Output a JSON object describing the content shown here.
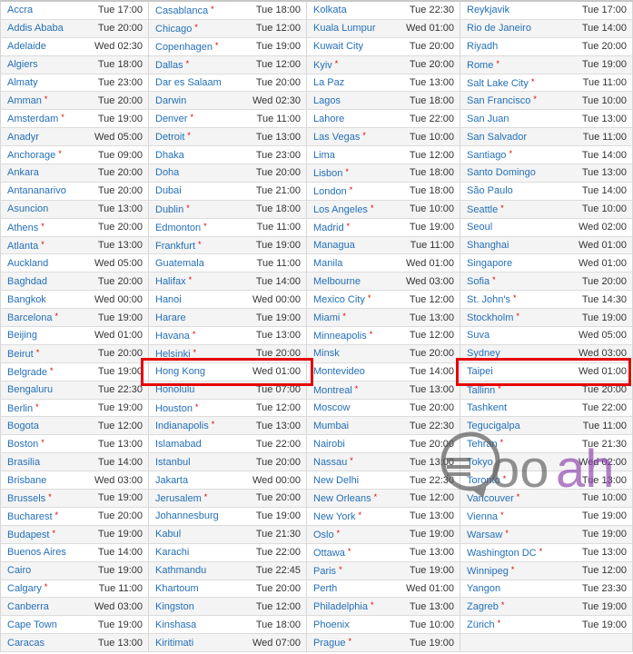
{
  "dst_marker": "*",
  "highlight_color": "#e50000",
  "link_color": "#2470b8",
  "watermark": {
    "text_gray": "Qoo",
    "text_purple": "ah",
    "gray": "#555555",
    "purple": "#8e44ad"
  },
  "highlighted_cities": [
    "Hong Kong",
    "Taipei"
  ],
  "columns": [
    [
      {
        "city": "Accra",
        "time": "Tue 17:00",
        "dst": false
      },
      {
        "city": "Addis Ababa",
        "time": "Tue 20:00",
        "dst": false
      },
      {
        "city": "Adelaide",
        "time": "Wed 02:30",
        "dst": false
      },
      {
        "city": "Algiers",
        "time": "Tue 18:00",
        "dst": false
      },
      {
        "city": "Almaty",
        "time": "Tue 23:00",
        "dst": false
      },
      {
        "city": "Amman",
        "time": "Tue 20:00",
        "dst": true
      },
      {
        "city": "Amsterdam",
        "time": "Tue 19:00",
        "dst": true
      },
      {
        "city": "Anadyr",
        "time": "Wed 05:00",
        "dst": false
      },
      {
        "city": "Anchorage",
        "time": "Tue 09:00",
        "dst": true
      },
      {
        "city": "Ankara",
        "time": "Tue 20:00",
        "dst": false
      },
      {
        "city": "Antananarivo",
        "time": "Tue 20:00",
        "dst": false
      },
      {
        "city": "Asuncion",
        "time": "Tue 13:00",
        "dst": false
      },
      {
        "city": "Athens",
        "time": "Tue 20:00",
        "dst": true
      },
      {
        "city": "Atlanta",
        "time": "Tue 13:00",
        "dst": true
      },
      {
        "city": "Auckland",
        "time": "Wed 05:00",
        "dst": false
      },
      {
        "city": "Baghdad",
        "time": "Tue 20:00",
        "dst": false
      },
      {
        "city": "Bangkok",
        "time": "Wed 00:00",
        "dst": false
      },
      {
        "city": "Barcelona",
        "time": "Tue 19:00",
        "dst": true
      },
      {
        "city": "Beijing",
        "time": "Wed 01:00",
        "dst": false
      },
      {
        "city": "Beirut",
        "time": "Tue 20:00",
        "dst": true
      },
      {
        "city": "Belgrade",
        "time": "Tue 19:00",
        "dst": true
      },
      {
        "city": "Bengaluru",
        "time": "Tue 22:30",
        "dst": false
      },
      {
        "city": "Berlin",
        "time": "Tue 19:00",
        "dst": true
      },
      {
        "city": "Bogota",
        "time": "Tue 12:00",
        "dst": false
      },
      {
        "city": "Boston",
        "time": "Tue 13:00",
        "dst": true
      },
      {
        "city": "Brasilia",
        "time": "Tue 14:00",
        "dst": false
      },
      {
        "city": "Brisbane",
        "time": "Wed 03:00",
        "dst": false
      },
      {
        "city": "Brussels",
        "time": "Tue 19:00",
        "dst": true
      },
      {
        "city": "Bucharest",
        "time": "Tue 20:00",
        "dst": true
      },
      {
        "city": "Budapest",
        "time": "Tue 19:00",
        "dst": true
      },
      {
        "city": "Buenos Aires",
        "time": "Tue 14:00",
        "dst": false
      },
      {
        "city": "Cairo",
        "time": "Tue 19:00",
        "dst": false
      },
      {
        "city": "Calgary",
        "time": "Tue 11:00",
        "dst": true
      },
      {
        "city": "Canberra",
        "time": "Wed 03:00",
        "dst": false
      },
      {
        "city": "Cape Town",
        "time": "Tue 19:00",
        "dst": false
      },
      {
        "city": "Caracas",
        "time": "Tue 13:00",
        "dst": false
      }
    ],
    [
      {
        "city": "Casablanca",
        "time": "Tue 18:00",
        "dst": true
      },
      {
        "city": "Chicago",
        "time": "Tue 12:00",
        "dst": true
      },
      {
        "city": "Copenhagen",
        "time": "Tue 19:00",
        "dst": true
      },
      {
        "city": "Dallas",
        "time": "Tue 12:00",
        "dst": true
      },
      {
        "city": "Dar es Salaam",
        "time": "Tue 20:00",
        "dst": false
      },
      {
        "city": "Darwin",
        "time": "Wed 02:30",
        "dst": false
      },
      {
        "city": "Denver",
        "time": "Tue 11:00",
        "dst": true
      },
      {
        "city": "Detroit",
        "time": "Tue 13:00",
        "dst": true
      },
      {
        "city": "Dhaka",
        "time": "Tue 23:00",
        "dst": false
      },
      {
        "city": "Doha",
        "time": "Tue 20:00",
        "dst": false
      },
      {
        "city": "Dubai",
        "time": "Tue 21:00",
        "dst": false
      },
      {
        "city": "Dublin",
        "time": "Tue 18:00",
        "dst": true
      },
      {
        "city": "Edmonton",
        "time": "Tue 11:00",
        "dst": true
      },
      {
        "city": "Frankfurt",
        "time": "Tue 19:00",
        "dst": true
      },
      {
        "city": "Guatemala",
        "time": "Tue 11:00",
        "dst": false
      },
      {
        "city": "Halifax",
        "time": "Tue 14:00",
        "dst": true
      },
      {
        "city": "Hanoi",
        "time": "Wed 00:00",
        "dst": false
      },
      {
        "city": "Harare",
        "time": "Tue 19:00",
        "dst": false
      },
      {
        "city": "Havana",
        "time": "Tue 13:00",
        "dst": true
      },
      {
        "city": "Helsinki",
        "time": "Tue 20:00",
        "dst": true
      },
      {
        "city": "Hong Kong",
        "time": "Wed 01:00",
        "dst": false
      },
      {
        "city": "Honolulu",
        "time": "Tue 07:00",
        "dst": false
      },
      {
        "city": "Houston",
        "time": "Tue 12:00",
        "dst": true
      },
      {
        "city": "Indianapolis",
        "time": "Tue 13:00",
        "dst": true
      },
      {
        "city": "Islamabad",
        "time": "Tue 22:00",
        "dst": false
      },
      {
        "city": "Istanbul",
        "time": "Tue 20:00",
        "dst": false
      },
      {
        "city": "Jakarta",
        "time": "Wed 00:00",
        "dst": false
      },
      {
        "city": "Jerusalem",
        "time": "Tue 20:00",
        "dst": true
      },
      {
        "city": "Johannesburg",
        "time": "Tue 19:00",
        "dst": false
      },
      {
        "city": "Kabul",
        "time": "Tue 21:30",
        "dst": false
      },
      {
        "city": "Karachi",
        "time": "Tue 22:00",
        "dst": false
      },
      {
        "city": "Kathmandu",
        "time": "Tue 22:45",
        "dst": false
      },
      {
        "city": "Khartoum",
        "time": "Tue 20:00",
        "dst": false
      },
      {
        "city": "Kingston",
        "time": "Tue 12:00",
        "dst": false
      },
      {
        "city": "Kinshasa",
        "time": "Tue 18:00",
        "dst": false
      },
      {
        "city": "Kiritimati",
        "time": "Wed 07:00",
        "dst": false
      }
    ],
    [
      {
        "city": "Kolkata",
        "time": "Tue 22:30",
        "dst": false
      },
      {
        "city": "Kuala Lumpur",
        "time": "Wed 01:00",
        "dst": false
      },
      {
        "city": "Kuwait City",
        "time": "Tue 20:00",
        "dst": false
      },
      {
        "city": "Kyiv",
        "time": "Tue 20:00",
        "dst": true
      },
      {
        "city": "La Paz",
        "time": "Tue 13:00",
        "dst": false
      },
      {
        "city": "Lagos",
        "time": "Tue 18:00",
        "dst": false
      },
      {
        "city": "Lahore",
        "time": "Tue 22:00",
        "dst": false
      },
      {
        "city": "Las Vegas",
        "time": "Tue 10:00",
        "dst": true
      },
      {
        "city": "Lima",
        "time": "Tue 12:00",
        "dst": false
      },
      {
        "city": "Lisbon",
        "time": "Tue 18:00",
        "dst": true
      },
      {
        "city": "London",
        "time": "Tue 18:00",
        "dst": true
      },
      {
        "city": "Los Angeles",
        "time": "Tue 10:00",
        "dst": true
      },
      {
        "city": "Madrid",
        "time": "Tue 19:00",
        "dst": true
      },
      {
        "city": "Managua",
        "time": "Tue 11:00",
        "dst": false
      },
      {
        "city": "Manila",
        "time": "Wed 01:00",
        "dst": false
      },
      {
        "city": "Melbourne",
        "time": "Wed 03:00",
        "dst": false
      },
      {
        "city": "Mexico City",
        "time": "Tue 12:00",
        "dst": true
      },
      {
        "city": "Miami",
        "time": "Tue 13:00",
        "dst": true
      },
      {
        "city": "Minneapolis",
        "time": "Tue 12:00",
        "dst": true
      },
      {
        "city": "Minsk",
        "time": "Tue 20:00",
        "dst": false
      },
      {
        "city": "Montevideo",
        "time": "Tue 14:00",
        "dst": false
      },
      {
        "city": "Montreal",
        "time": "Tue 13:00",
        "dst": true
      },
      {
        "city": "Moscow",
        "time": "Tue 20:00",
        "dst": false
      },
      {
        "city": "Mumbai",
        "time": "Tue 22:30",
        "dst": false
      },
      {
        "city": "Nairobi",
        "time": "Tue 20:00",
        "dst": false
      },
      {
        "city": "Nassau",
        "time": "Tue 13:00",
        "dst": true
      },
      {
        "city": "New Delhi",
        "time": "Tue 22:30",
        "dst": false
      },
      {
        "city": "New Orleans",
        "time": "Tue 12:00",
        "dst": true
      },
      {
        "city": "New York",
        "time": "Tue 13:00",
        "dst": true
      },
      {
        "city": "Oslo",
        "time": "Tue 19:00",
        "dst": true
      },
      {
        "city": "Ottawa",
        "time": "Tue 13:00",
        "dst": true
      },
      {
        "city": "Paris",
        "time": "Tue 19:00",
        "dst": true
      },
      {
        "city": "Perth",
        "time": "Wed 01:00",
        "dst": false
      },
      {
        "city": "Philadelphia",
        "time": "Tue 13:00",
        "dst": true
      },
      {
        "city": "Phoenix",
        "time": "Tue 10:00",
        "dst": false
      },
      {
        "city": "Prague",
        "time": "Tue 19:00",
        "dst": true
      }
    ],
    [
      {
        "city": "Reykjavik",
        "time": "Tue 17:00",
        "dst": false
      },
      {
        "city": "Rio de Janeiro",
        "time": "Tue 14:00",
        "dst": false
      },
      {
        "city": "Riyadh",
        "time": "Tue 20:00",
        "dst": false
      },
      {
        "city": "Rome",
        "time": "Tue 19:00",
        "dst": true
      },
      {
        "city": "Salt Lake City",
        "time": "Tue 11:00",
        "dst": true
      },
      {
        "city": "San Francisco",
        "time": "Tue 10:00",
        "dst": true
      },
      {
        "city": "San Juan",
        "time": "Tue 13:00",
        "dst": false
      },
      {
        "city": "San Salvador",
        "time": "Tue 11:00",
        "dst": false
      },
      {
        "city": "Santiago",
        "time": "Tue 14:00",
        "dst": true
      },
      {
        "city": "Santo Domingo",
        "time": "Tue 13:00",
        "dst": false
      },
      {
        "city": "São Paulo",
        "time": "Tue 14:00",
        "dst": false
      },
      {
        "city": "Seattle",
        "time": "Tue 10:00",
        "dst": true
      },
      {
        "city": "Seoul",
        "time": "Wed 02:00",
        "dst": false
      },
      {
        "city": "Shanghai",
        "time": "Wed 01:00",
        "dst": false
      },
      {
        "city": "Singapore",
        "time": "Wed 01:00",
        "dst": false
      },
      {
        "city": "Sofia",
        "time": "Tue 20:00",
        "dst": true
      },
      {
        "city": "St. John's",
        "time": "Tue 14:30",
        "dst": true
      },
      {
        "city": "Stockholm",
        "time": "Tue 19:00",
        "dst": true
      },
      {
        "city": "Suva",
        "time": "Wed 05:00",
        "dst": false
      },
      {
        "city": "Sydney",
        "time": "Wed 03:00",
        "dst": false
      },
      {
        "city": "Taipei",
        "time": "Wed 01:00",
        "dst": false
      },
      {
        "city": "Tallinn",
        "time": "Tue 20:00",
        "dst": true
      },
      {
        "city": "Tashkent",
        "time": "Tue 22:00",
        "dst": false
      },
      {
        "city": "Tegucigalpa",
        "time": "Tue 11:00",
        "dst": false
      },
      {
        "city": "Tehran",
        "time": "Tue 21:30",
        "dst": true
      },
      {
        "city": "Tokyo",
        "time": "Wed 02:00",
        "dst": false
      },
      {
        "city": "Toronto",
        "time": "Tue 13:00",
        "dst": true
      },
      {
        "city": "Vancouver",
        "time": "Tue 10:00",
        "dst": true
      },
      {
        "city": "Vienna",
        "time": "Tue 19:00",
        "dst": true
      },
      {
        "city": "Warsaw",
        "time": "Tue 19:00",
        "dst": true
      },
      {
        "city": "Washington DC",
        "time": "Tue 13:00",
        "dst": true
      },
      {
        "city": "Winnipeg",
        "time": "Tue 12:00",
        "dst": true
      },
      {
        "city": "Yangon",
        "time": "Tue 23:30",
        "dst": false
      },
      {
        "city": "Zagreb",
        "time": "Tue 19:00",
        "dst": true
      },
      {
        "city": "Zürich",
        "time": "Tue 19:00",
        "dst": true
      },
      {
        "city": "",
        "time": "",
        "dst": false
      }
    ]
  ]
}
